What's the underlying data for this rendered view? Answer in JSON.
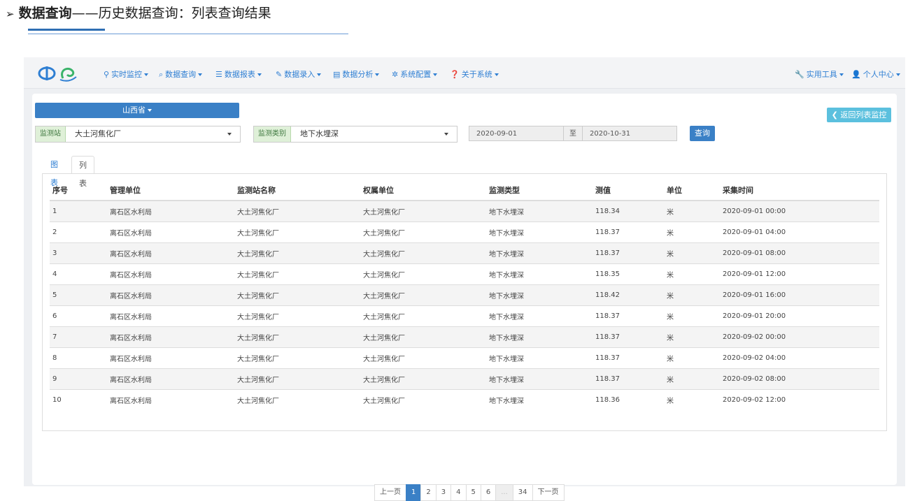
{
  "doc": {
    "arrow": "➢",
    "heading_bold": "数据查询",
    "heading_rest": "——历史数据查询：列表查询结果"
  },
  "navbar": {
    "items": [
      {
        "icon": "location-icon",
        "glyph": "⚲",
        "label": "实时监控"
      },
      {
        "icon": "search-icon",
        "glyph": "⌕",
        "label": "数据查询"
      },
      {
        "icon": "list-icon",
        "glyph": "☰",
        "label": "数据报表"
      },
      {
        "icon": "edit-icon",
        "glyph": "✎",
        "label": "数据录入"
      },
      {
        "icon": "chart-icon",
        "glyph": "▤",
        "label": "数据分析"
      },
      {
        "icon": "gear-icon",
        "glyph": "✲",
        "label": "系统配置"
      },
      {
        "icon": "question-icon",
        "glyph": "❓",
        "label": "关于系统"
      }
    ],
    "tools": {
      "glyph": "🔧",
      "label": "实用工具"
    },
    "user": {
      "glyph": "👤",
      "label": "个人中心"
    }
  },
  "filters": {
    "province": "山西省",
    "back_label": "返回列表监控",
    "station_addon": "监测站",
    "station_value": "大土河焦化厂",
    "type_addon": "监测类别",
    "type_value": "地下水埋深",
    "date_from": "2020-09-01",
    "date_sep": "至",
    "date_to": "2020-10-31",
    "query_label": "查询"
  },
  "tabs": [
    "图表",
    "列表"
  ],
  "table": {
    "headers": [
      "序号",
      "管理单位",
      "监测站名称",
      "权属单位",
      "监测类型",
      "测值",
      "单位",
      "采集时间"
    ],
    "rows": [
      [
        "1",
        "离石区水利局",
        "大土河焦化厂",
        "大土河焦化厂",
        "地下水埋深",
        "118.34",
        "米",
        "2020-09-01 00:00"
      ],
      [
        "2",
        "离石区水利局",
        "大土河焦化厂",
        "大土河焦化厂",
        "地下水埋深",
        "118.37",
        "米",
        "2020-09-01 04:00"
      ],
      [
        "3",
        "离石区水利局",
        "大土河焦化厂",
        "大土河焦化厂",
        "地下水埋深",
        "118.37",
        "米",
        "2020-09-01 08:00"
      ],
      [
        "4",
        "离石区水利局",
        "大土河焦化厂",
        "大土河焦化厂",
        "地下水埋深",
        "118.35",
        "米",
        "2020-09-01 12:00"
      ],
      [
        "5",
        "离石区水利局",
        "大土河焦化厂",
        "大土河焦化厂",
        "地下水埋深",
        "118.42",
        "米",
        "2020-09-01 16:00"
      ],
      [
        "6",
        "离石区水利局",
        "大土河焦化厂",
        "大土河焦化厂",
        "地下水埋深",
        "118.37",
        "米",
        "2020-09-01 20:00"
      ],
      [
        "7",
        "离石区水利局",
        "大土河焦化厂",
        "大土河焦化厂",
        "地下水埋深",
        "118.37",
        "米",
        "2020-09-02 00:00"
      ],
      [
        "8",
        "离石区水利局",
        "大土河焦化厂",
        "大土河焦化厂",
        "地下水埋深",
        "118.37",
        "米",
        "2020-09-02 04:00"
      ],
      [
        "9",
        "离石区水利局",
        "大土河焦化厂",
        "大土河焦化厂",
        "地下水埋深",
        "118.37",
        "米",
        "2020-09-02 08:00"
      ],
      [
        "10",
        "离石区水利局",
        "大土河焦化厂",
        "大土河焦化厂",
        "地下水埋深",
        "118.36",
        "米",
        "2020-09-02 12:00"
      ]
    ]
  },
  "pagination": {
    "prev": "上一页",
    "pages": [
      "1",
      "2",
      "3",
      "4",
      "5",
      "6",
      "...",
      "34"
    ],
    "current": "1",
    "next": "下一页"
  },
  "colors": {
    "primary": "#3a80c6",
    "info": "#5bc0de",
    "addon_bg": "#dff0d8"
  }
}
